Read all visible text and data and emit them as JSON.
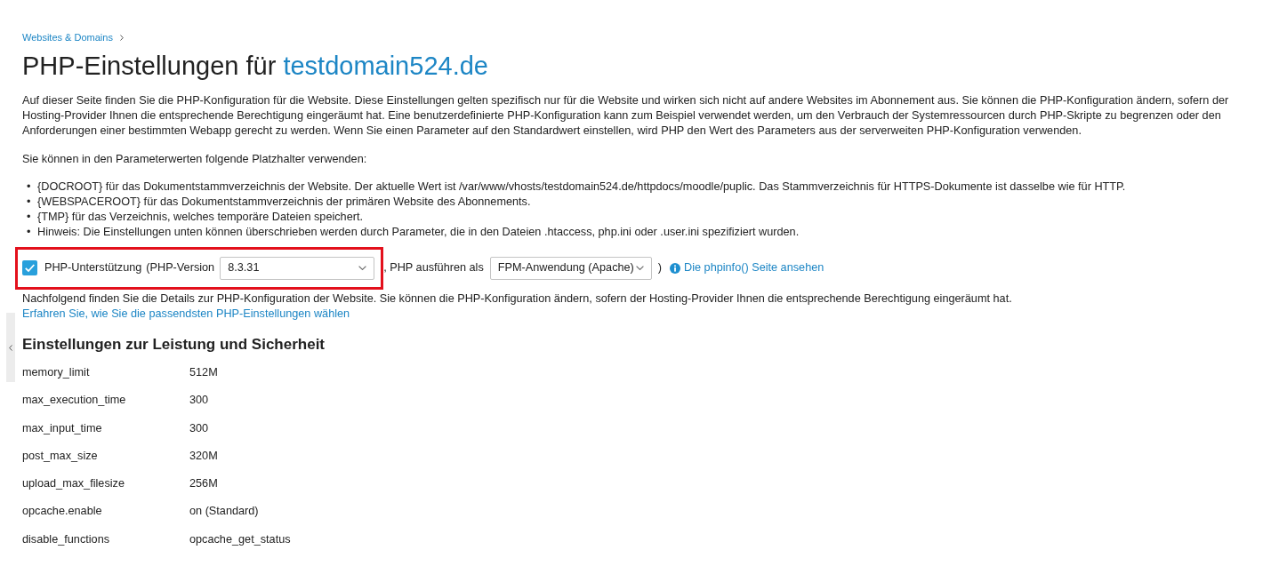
{
  "breadcrumb": [
    {
      "label": "Websites & Domains"
    }
  ],
  "title": {
    "text": "PHP-Einstellungen für",
    "domain": "testdomain524.de"
  },
  "intro": "Auf dieser Seite finden Sie die PHP-Konfiguration für die Website. Diese Einstellungen gelten spezifisch nur für die Website und wirken sich nicht auf andere Websites im Abonnement aus. Sie können die PHP-Konfiguration ändern, sofern der Hosting-Provider Ihnen die entsprechende Berechtigung eingeräumt hat. Eine benutzerdefinierte PHP-Konfiguration kann zum Beispiel verwendet werden, um den Verbrauch der Systemressourcen durch PHP-Skripte zu begrenzen oder den Anforderungen einer bestimmten Webapp gerecht zu werden. Wenn Sie einen Parameter auf den Standardwert einstellen, wird PHP den Wert des Parameters aus der serverweiten PHP-Konfiguration verwenden.",
  "placeholders_intro": "Sie können in den Parameterwerten folgende Platzhalter verwenden:",
  "placeholders": [
    {
      "marker": "•",
      "text": "{DOCROOT} für das Dokumentstammverzeichnis der Website. Der aktuelle Wert ist /var/www/vhosts/testdomain524.de/httpdocs/moodle/puplic. Das Stammverzeichnis für HTTPS-Dokumente ist dasselbe wie für HTTP."
    },
    {
      "marker": "•",
      "text": "{WEBSPACEROOT} für das Dokumentstammverzeichnis der primären Website des Abonnements."
    },
    {
      "marker": "•",
      "text": "{TMP} für das Verzeichnis, welches temporäre Dateien speichert."
    },
    {
      "marker": "•",
      "text": "Hinweis: Die Einstellungen unten können überschrieben werden durch Parameter, die in den Dateien .htaccess, php.ini oder .user.ini spezifiziert wurden."
    }
  ],
  "php_support": {
    "highlighted": true,
    "checked": true,
    "label": "PHP-Unterstützung",
    "version_label": "(PHP-Version",
    "version": "8.3.31",
    "run_as_label": ", PHP ausführen als",
    "handler": "FPM-Anwendung (Apache)",
    "closing": ")",
    "phpinfo_link": "Die phpinfo() Seite ansehen"
  },
  "details": {
    "text": "Nachfolgend finden Sie die Details zur PHP-Konfiguration der Website. Sie können die PHP-Konfiguration ändern, sofern der Hosting-Provider Ihnen die entsprechende Berechtigung eingeräumt hat.",
    "link": "Erfahren Sie, wie Sie die passendsten PHP-Einstellungen wählen"
  },
  "section": {
    "title": "Einstellungen zur Leistung und Sicherheit",
    "settings": [
      {
        "name": "memory_limit",
        "value": "512M"
      },
      {
        "name": "max_execution_time",
        "value": "300"
      },
      {
        "name": "max_input_time",
        "value": "300"
      },
      {
        "name": "post_max_size",
        "value": "320M"
      },
      {
        "name": "upload_max_filesize",
        "value": "256M"
      },
      {
        "name": "opcache.enable",
        "value": "on (Standard)"
      },
      {
        "name": "disable_functions",
        "value": "opcache_get_status"
      }
    ]
  }
}
